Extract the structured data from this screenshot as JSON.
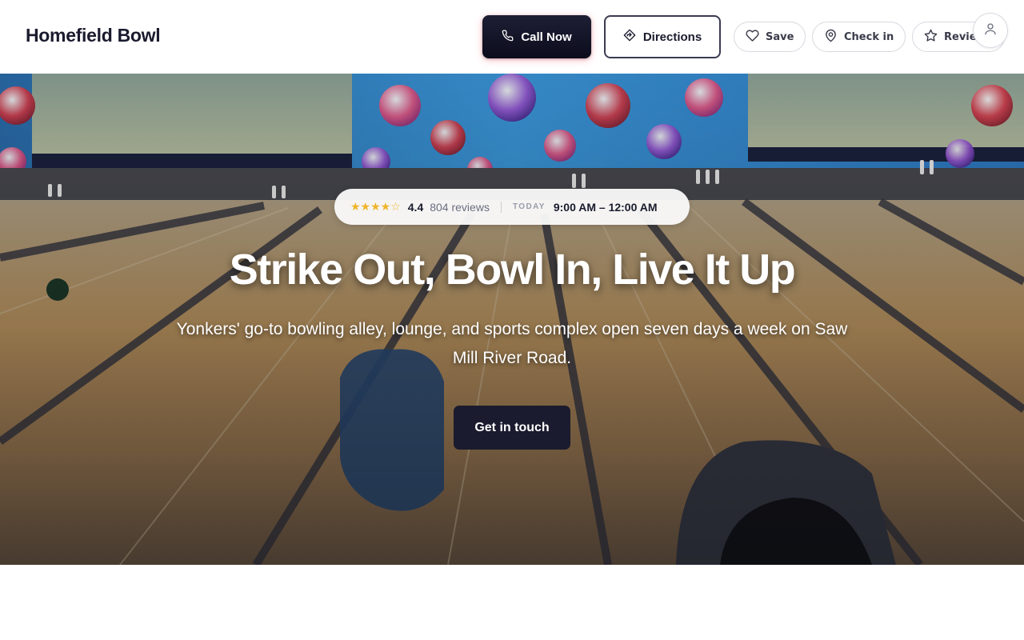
{
  "header": {
    "brand": "Homefield Bowl",
    "call_label": "Call Now",
    "directions_label": "Directions",
    "save_label": "Save",
    "checkin_label": "Check in",
    "review_label": "Review"
  },
  "hero": {
    "stars": "★★★★☆",
    "rating": "4.4",
    "reviews": "804 reviews",
    "today_label": "TODAY",
    "hours": "9:00 AM – 12:00 AM",
    "title": "Strike Out, Bowl In, Live It Up",
    "subtitle": "Yonkers' go-to bowling alley, lounge, and sports complex open seven days a week on Saw Mill River Road.",
    "cta_label": "Get in touch"
  },
  "colors": {
    "primary": "#1a1b2e",
    "star": "#f0b429",
    "accent_glow": "#ff5a6e"
  },
  "icons": [
    "phone-icon",
    "directions-icon",
    "heart-icon",
    "map-pin-icon",
    "star-icon",
    "user-icon"
  ]
}
